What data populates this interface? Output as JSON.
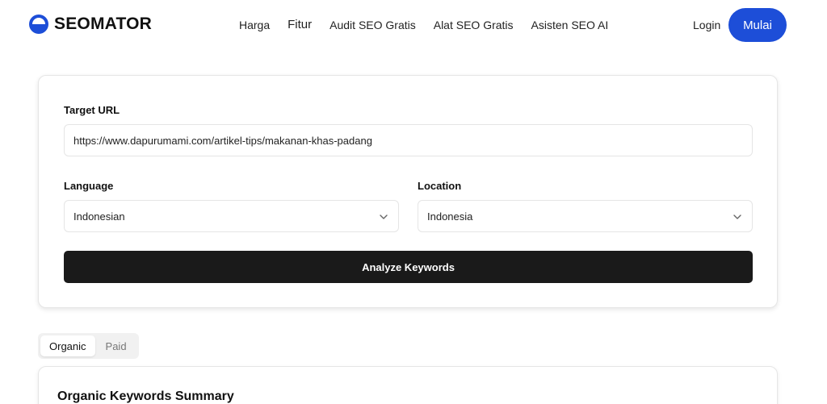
{
  "header": {
    "logo_text": "SEOMATOR",
    "nav": [
      {
        "label": "Harga"
      },
      {
        "label": "Fitur"
      },
      {
        "label": "Audit SEO Gratis"
      },
      {
        "label": "Alat SEO Gratis"
      },
      {
        "label": "Asisten SEO AI"
      }
    ],
    "login_label": "Login",
    "cta_label": "Mulai"
  },
  "form": {
    "target_url_label": "Target URL",
    "target_url_value": "https://www.dapurumami.com/artikel-tips/makanan-khas-padang",
    "language_label": "Language",
    "language_value": "Indonesian",
    "location_label": "Location",
    "location_value": "Indonesia",
    "analyze_label": "Analyze Keywords"
  },
  "tabs": [
    {
      "label": "Organic",
      "active": true
    },
    {
      "label": "Paid",
      "active": false
    }
  ],
  "summary": {
    "title": "Organic Keywords Summary"
  },
  "colors": {
    "accent": "#1d4ed8",
    "button_dark": "#1a1a1a"
  },
  "icons": [
    "seomator-logo-icon",
    "chevron-down-icon"
  ]
}
